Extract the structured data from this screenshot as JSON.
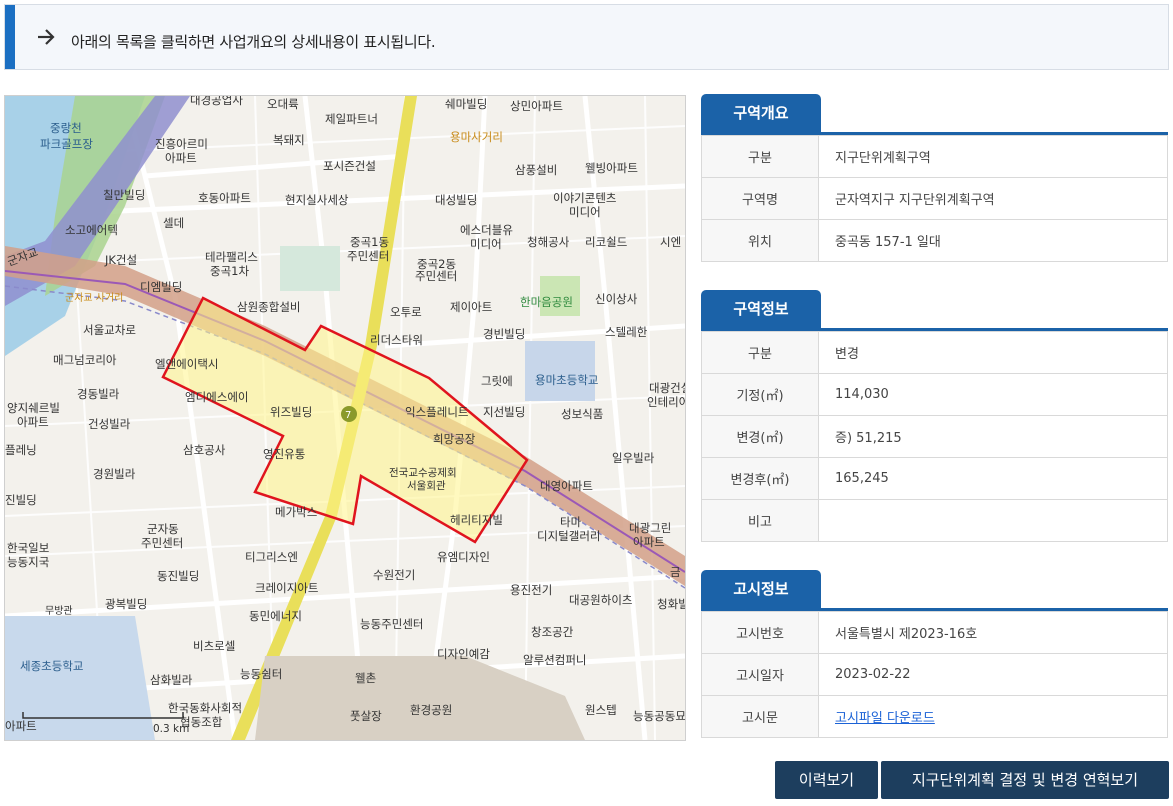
{
  "notice": {
    "message": "아래의 목록을 클릭하면 사업개요의 상세내용이 표시됩니다."
  },
  "map": {
    "scale_label": "0.3 km",
    "labels": [
      "대경공업사",
      "오대륙",
      "제일파트너",
      "쉐마빌딩",
      "상민아파트",
      "중랑천 파크골프장",
      "진흥아르미 아파트",
      "복돼지",
      "용마사거리",
      "포시즌건설",
      "삼풍설비",
      "웰빙아파트",
      "칠만빌딩",
      "호동아파트",
      "현지실사세상",
      "대성빌딩",
      "이야기콘텐츠 미디어",
      "셀데",
      "소고에어텍",
      "에스더블유 미디어",
      "청해공사",
      "리코쉴드",
      "시엔",
      "중곡1동 주민센터",
      "중곡2동 주민센터",
      "JK건설",
      "테라팰리스 중곡1차",
      "군자교",
      "디엠빌딩",
      "한마음공원",
      "신이상사",
      "군자교 사거리",
      "삼원종합설비",
      "오투로",
      "제이아트",
      "스텔레한",
      "서울교차로",
      "리더스타워",
      "경빈빌딩",
      "매그넘코리아",
      "엘앤에이택시",
      "그릿에",
      "용마초등학교",
      "대광건설 인테리어",
      "경동빌라",
      "위즈빌딩",
      "지선빌딩",
      "성보식품",
      "양지쉐르빌 아파트",
      "건성빌라",
      "엠디에스에이",
      "플레닝",
      "삼호공사",
      "희망공장",
      "일우빌라",
      "경원빌라",
      "진빌딩",
      "대영아파트",
      "군자동 주민센터",
      "타마 디지털갤러리",
      "대광그린 아파트",
      "한국일보 능동지국",
      "티그리스엔",
      "유엠디자인",
      "동진빌딩",
      "크레이지아트",
      "수원전기",
      "광복빌딩",
      "용진전기",
      "대공원하이츠",
      "청화빌",
      "동민에너지",
      "무방관",
      "능동주민센터",
      "창조공간",
      "비츠로셀",
      "세종초등학교",
      "디자인예감",
      "알루션컴퍼니",
      "능동쉼터",
      "삼화빌라",
      "웰촌",
      "한국동화사회적 협동조합",
      "풋살장",
      "환경공원",
      "원스텝",
      "능동공동묘",
      "아파트",
      "전국교수공제회 서울회관",
      "헤리티지빌"
    ]
  },
  "sections": {
    "district_overview": {
      "title": "구역개요",
      "rows": [
        {
          "label": "구분",
          "value": "지구단위계획구역"
        },
        {
          "label": "구역명",
          "value": "군자역지구 지구단위계획구역"
        },
        {
          "label": "위치",
          "value": "중곡동 157-1 일대"
        }
      ]
    },
    "district_info": {
      "title": "구역정보",
      "rows": [
        {
          "label": "구분",
          "value": "변경"
        },
        {
          "label": "기정(㎡)",
          "value": "114,030"
        },
        {
          "label": "변경(㎡)",
          "value": "증) 51,215"
        },
        {
          "label": "변경후(㎡)",
          "value": "165,245"
        },
        {
          "label": "비고",
          "value": ""
        }
      ]
    },
    "notice_info": {
      "title": "고시정보",
      "rows": [
        {
          "label": "고시번호",
          "value": "서울특별시 제2023-16호"
        },
        {
          "label": "고시일자",
          "value": "2023-02-22"
        },
        {
          "label": "고시문",
          "value": "고시파일 다운로드"
        }
      ]
    }
  },
  "buttons": {
    "history": "이력보기",
    "decision_history": "지구단위계획 결정 및 변경 연혁보기"
  },
  "colors": {
    "accent": "#1b62a8",
    "button": "#1d3e5e",
    "district_outline": "#e0141e",
    "district_fill": "#fff48a"
  }
}
